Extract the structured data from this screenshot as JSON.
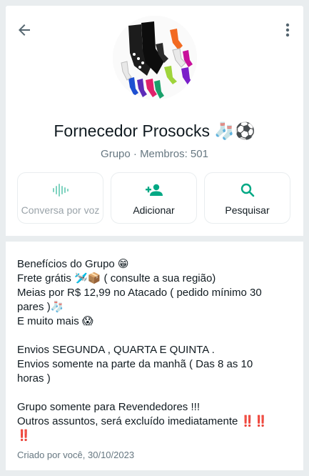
{
  "header": {
    "back_icon": "arrow-left-icon",
    "menu_icon": "more-vertical-icon"
  },
  "group": {
    "name": "Fornecedor Prosocks 🧦⚽",
    "meta": "Grupo · Membros: 501",
    "avatar_icon": "socks-collage-avatar"
  },
  "actions": [
    {
      "label": "Conversa por voz",
      "icon": "voice-wave-icon",
      "enabled": false
    },
    {
      "label": "Adicionar",
      "icon": "add-person-icon",
      "enabled": true
    },
    {
      "label": "Pesquisar",
      "icon": "search-icon",
      "enabled": true
    }
  ],
  "description": {
    "lines": [
      "Benefícios do Grupo 😁",
      "Frete grátis 🛩️📦 ( consulte a sua região)",
      "Meias por R$ 12,99  no Atacado ( pedido mínimo 30",
      "pares )🧦",
      "E muito mais 😱",
      "",
      "Envios SEGUNDA , QUARTA E QUINTA .",
      "Envios somente na parte da manhã (  Das 8 as 10",
      "horas )",
      "",
      "Grupo somente para Revendedores !!!",
      "Outros assuntos, será excluído imediatamente ‼️‼️",
      "‼️"
    ],
    "created": "Criado por você, 30/10/2023"
  },
  "colors": {
    "accent": "#00a884",
    "accent_disabled": "#7fd3c0",
    "background": "#e9edef",
    "secondary_text": "#667781"
  }
}
